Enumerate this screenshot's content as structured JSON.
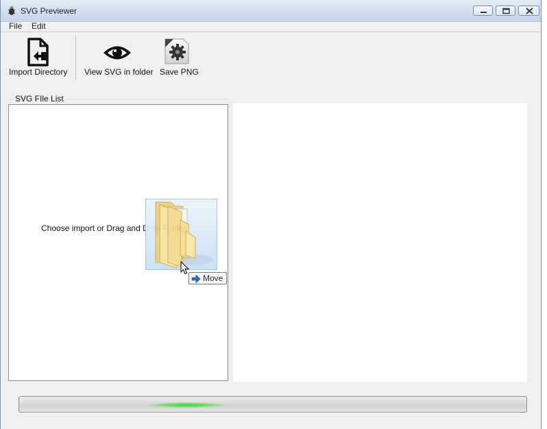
{
  "window": {
    "title": "SVG Previewer",
    "icon": "bug-icon",
    "controls": [
      "minimize-icon",
      "maximize-icon",
      "close-icon"
    ]
  },
  "menu": {
    "items": [
      {
        "label": "File"
      },
      {
        "label": "Edit"
      }
    ]
  },
  "toolbar": {
    "import_label": "Import Directory",
    "import_icon": "file-import-icon",
    "view_label": "View SVG in folder",
    "view_icon": "eye-icon",
    "save_label": "Save PNG",
    "save_icon": "png-gear-icon"
  },
  "file_list": {
    "group_label": "SVG FIle List",
    "hint": "Choose import or Drag and Drop Folder"
  },
  "drag": {
    "icon": "folder-icon",
    "tooltip": "Move",
    "tooltip_icon": "arrow-right-icon"
  },
  "progress": {
    "state": "indeterminate",
    "color": "#33e02c"
  }
}
